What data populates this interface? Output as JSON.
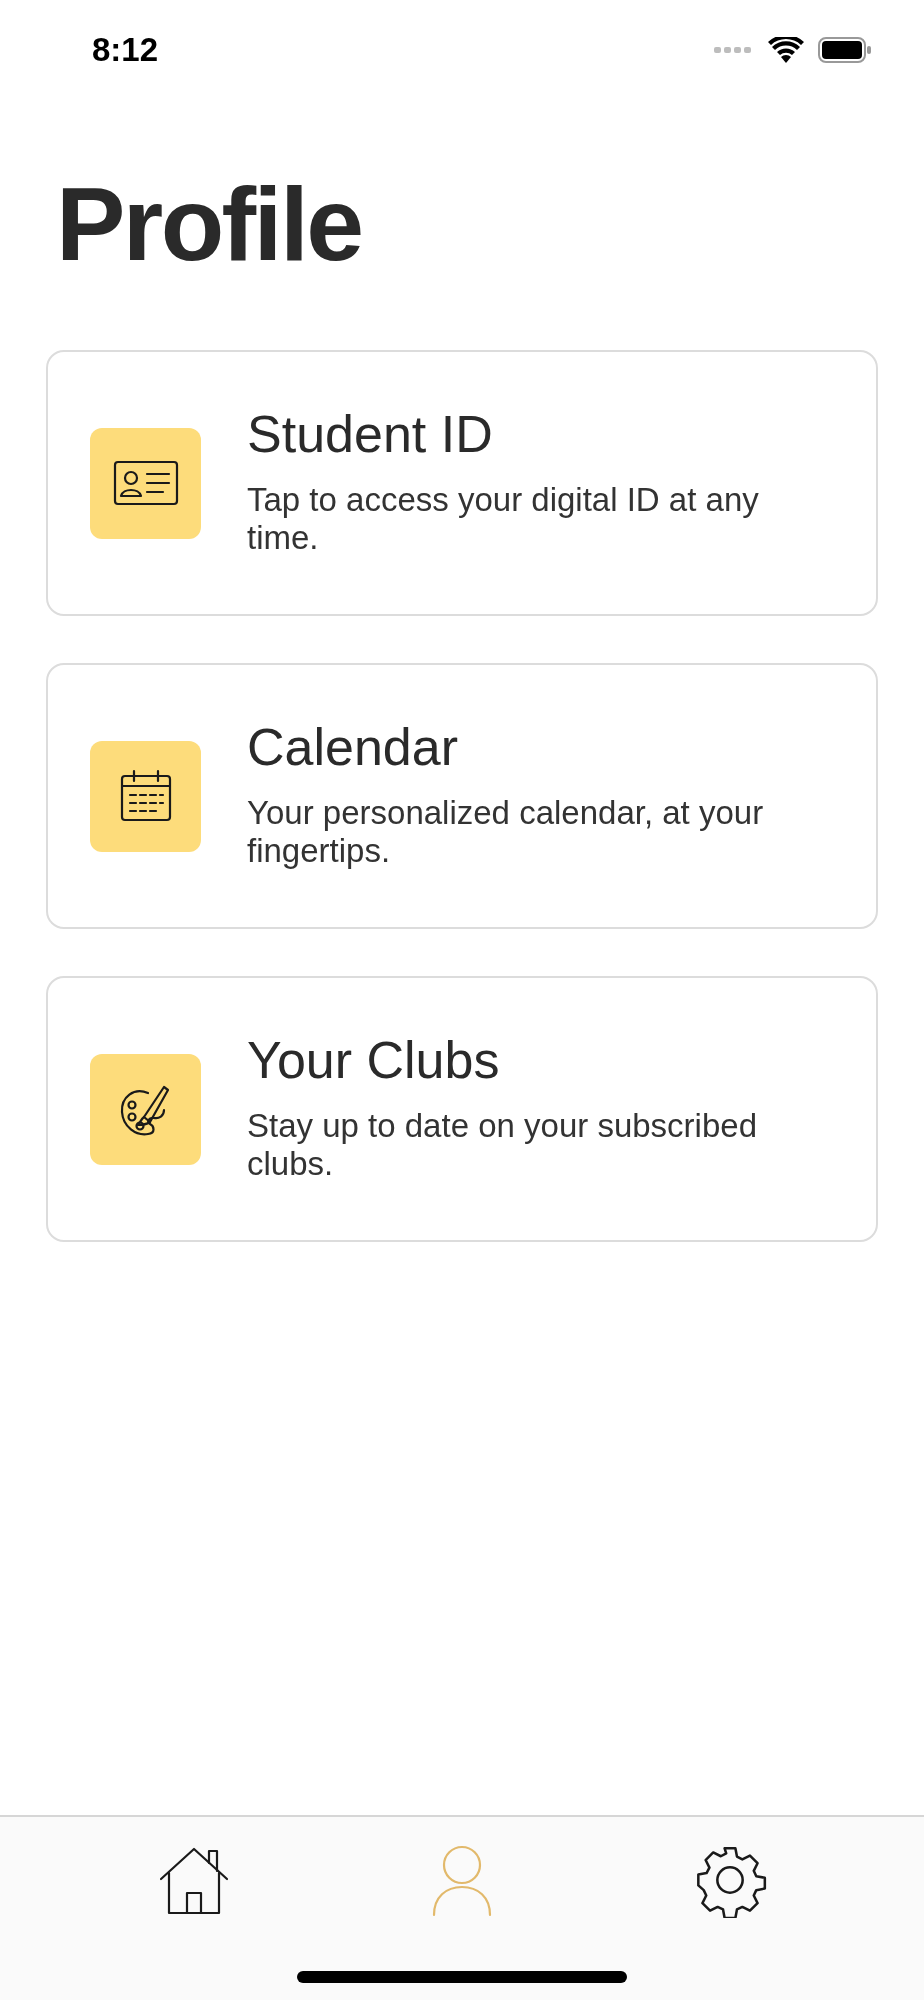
{
  "status_bar": {
    "time": "8:12"
  },
  "title": "Profile",
  "cards": [
    {
      "kind": "id",
      "title": "Student ID",
      "description": "Tap to access your digital ID at any time."
    },
    {
      "kind": "calendar",
      "title": "Calendar",
      "description": "Your personalized calendar, at your fingertips."
    },
    {
      "kind": "palette",
      "title": "Your Clubs",
      "description": "Stay up to date on your subscribed clubs."
    }
  ],
  "tab_bar": [
    {
      "kind": "home",
      "selected": false
    },
    {
      "kind": "profile",
      "selected": true
    },
    {
      "kind": "settings",
      "selected": false
    }
  ]
}
